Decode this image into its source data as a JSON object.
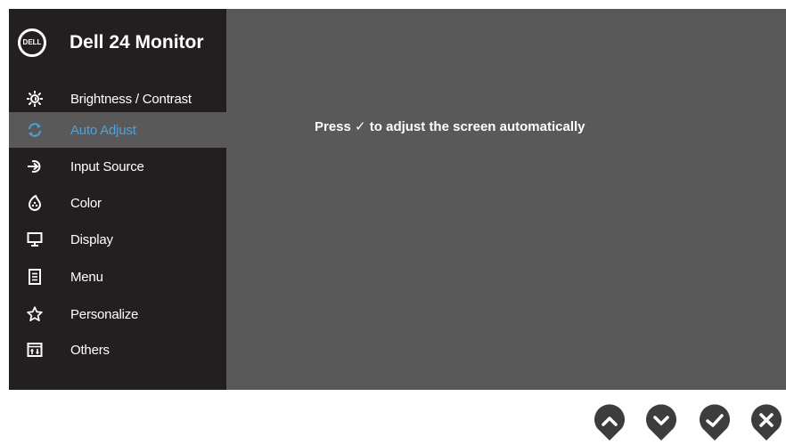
{
  "brand": {
    "logo_text": "DELL",
    "title": "Dell 24 Monitor"
  },
  "menu": {
    "items": [
      {
        "label": "Brightness / Contrast",
        "icon": "brightness-icon"
      },
      {
        "label": "Auto Adjust",
        "icon": "auto-adjust-icon",
        "active": true
      },
      {
        "label": "Input Source",
        "icon": "input-source-icon"
      },
      {
        "label": "Color",
        "icon": "color-icon"
      },
      {
        "label": "Display",
        "icon": "display-icon"
      },
      {
        "label": "Menu",
        "icon": "menu-icon"
      },
      {
        "label": "Personalize",
        "icon": "star-icon"
      },
      {
        "label": "Others",
        "icon": "others-icon"
      }
    ]
  },
  "content": {
    "message": "Press ✓ to adjust the screen automatically"
  },
  "buttons": [
    {
      "name": "up-button",
      "icon": "chevron-up-icon"
    },
    {
      "name": "down-button",
      "icon": "chevron-down-icon"
    },
    {
      "name": "ok-button",
      "icon": "check-icon"
    },
    {
      "name": "exit-button",
      "icon": "close-icon"
    }
  ],
  "colors": {
    "sidebar": "#231f20",
    "panel": "#595959",
    "accent": "#4aa3df",
    "button": "#3d3d3d"
  }
}
